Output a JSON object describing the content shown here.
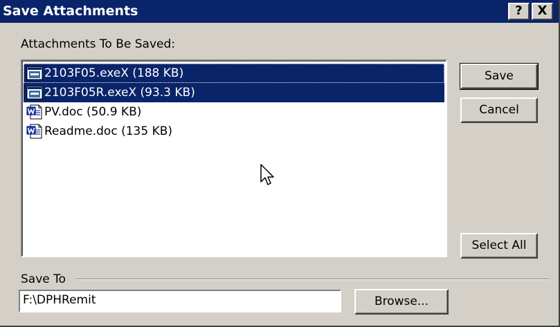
{
  "window": {
    "title": "Save Attachments",
    "help_glyph": "?",
    "close_glyph": "X"
  },
  "attachments_label": "Attachments To Be Saved:",
  "attachments": [
    {
      "label": "2103F05.exeX (188 KB)",
      "icon": "exe-file-icon",
      "selected": true
    },
    {
      "label": "2103F05R.exeX (93.3 KB)",
      "icon": "exe-file-icon",
      "selected": true
    },
    {
      "label": "PV.doc (50.9 KB)",
      "icon": "word-doc-icon",
      "selected": false
    },
    {
      "label": "Readme.doc (135 KB)",
      "icon": "word-doc-icon",
      "selected": false
    }
  ],
  "buttons": {
    "save": "Save",
    "cancel": "Cancel",
    "select_all": "Select All",
    "browse": "Browse..."
  },
  "save_to": {
    "label": "Save To",
    "path": "F:\\DPHRemit"
  },
  "colors": {
    "titlebar": "#0a246a",
    "selection": "#0a246a",
    "face": "#d4d0c8"
  }
}
